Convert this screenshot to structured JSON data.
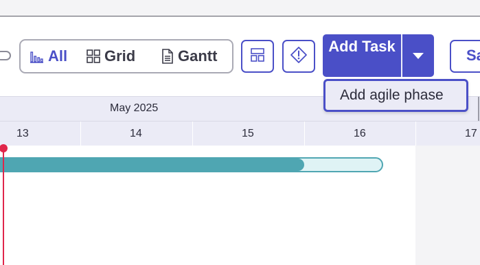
{
  "view_switch": {
    "options": [
      {
        "label": "All",
        "icon": "bar-chart-icon",
        "selected": true
      },
      {
        "label": "Grid",
        "icon": "grid-icon",
        "selected": false
      },
      {
        "label": "Gantt",
        "icon": "document-icon",
        "selected": false
      }
    ]
  },
  "toolbar": {
    "layout_button_icon": "layout-icon",
    "warning_button_icon": "warning-diamond-icon",
    "add_task_label": "Add Task",
    "add_task_menu_icon": "chevron-down-icon",
    "save_label": "Sa"
  },
  "dropdown": {
    "items": [
      {
        "label": "Add agile phase"
      }
    ]
  },
  "timeline": {
    "month": "May 2025",
    "days": [
      "13",
      "14",
      "15",
      "16",
      "17"
    ],
    "tasks": [
      {
        "progress": 0.8
      }
    ]
  },
  "colors": {
    "accent": "#4a4fc7",
    "task_bar": "#4fa6b2",
    "task_bar_track": "#dff3f5",
    "today_marker": "#e0264a",
    "header_bg": "#ebebf6"
  }
}
